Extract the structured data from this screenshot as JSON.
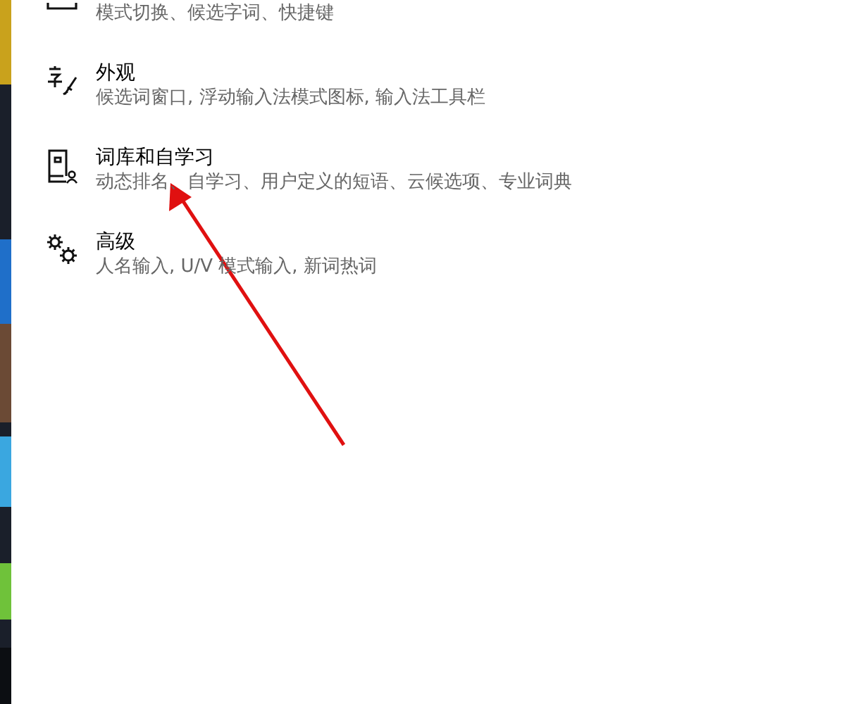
{
  "settings_items": [
    {
      "kind": "keyboard",
      "description": "模式切换、候选字词、快捷键"
    },
    {
      "kind": "appearance",
      "title": "外观",
      "description": "候选词窗口, 浮动输入法模式图标, 输入法工具栏"
    },
    {
      "kind": "dictionary",
      "title": "词库和自学习",
      "description": "动态排名、自学习、用户定义的短语、云候选项、专业词典"
    },
    {
      "kind": "advanced",
      "title": "高级",
      "description": "人名输入, U/V 模式输入, 新词热词"
    }
  ]
}
